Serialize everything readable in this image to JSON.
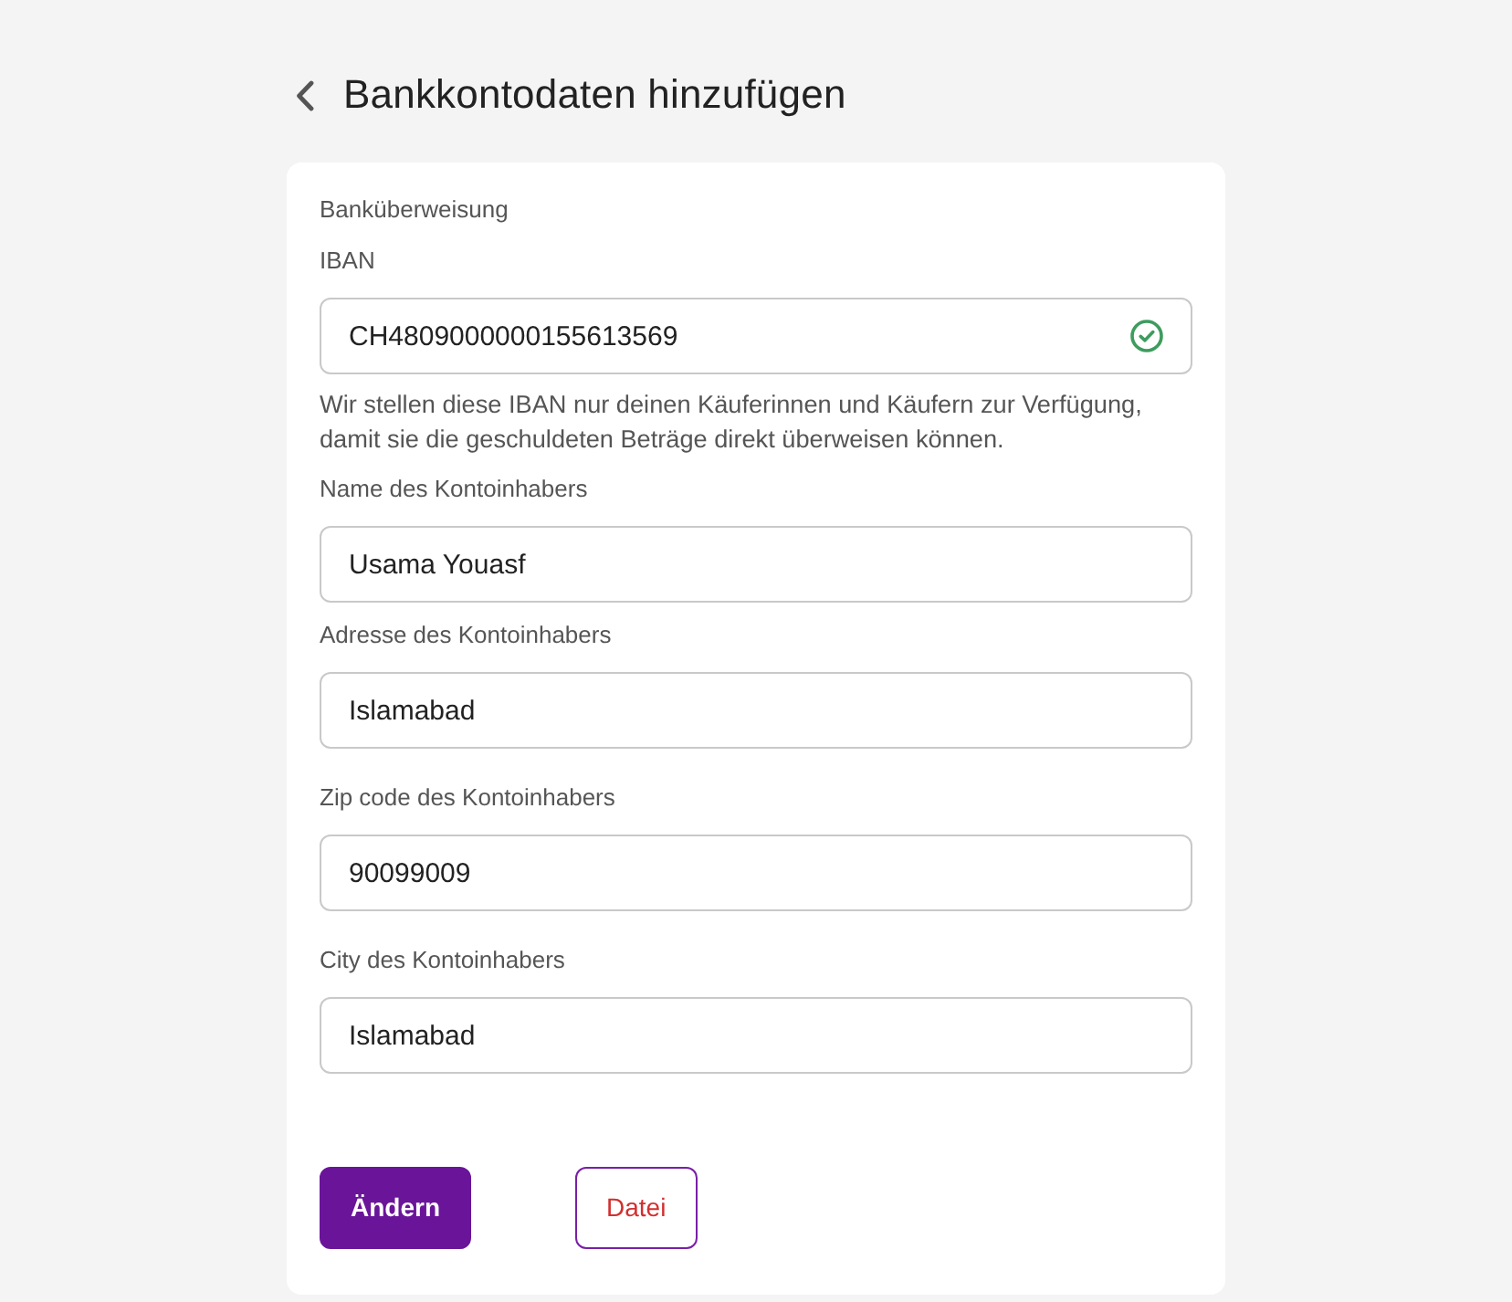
{
  "header": {
    "title": "Bankkontodaten hinzufügen"
  },
  "form": {
    "section_title": "Banküberweisung",
    "fields": [
      {
        "label": "IBAN",
        "value": "CH4809000000155613569",
        "valid": true,
        "hint": "Wir stellen diese IBAN nur deinen Käuferinnen und Käufern zur Verfügung, damit sie die geschuldeten Beträge direkt überweisen können."
      },
      {
        "label": "Name des Kontoinhabers",
        "value": "Usama Youasf"
      },
      {
        "label": "Adresse des Kontoinhabers",
        "value": "Islamabad"
      },
      {
        "label": "Zip code des Kontoinhabers",
        "value": "90099009"
      },
      {
        "label": "City des Kontoinhabers",
        "value": "Islamabad"
      }
    ],
    "buttons": [
      {
        "label": "Ändern",
        "kind": "primary"
      },
      {
        "label": "Datei",
        "kind": "outline"
      }
    ]
  }
}
